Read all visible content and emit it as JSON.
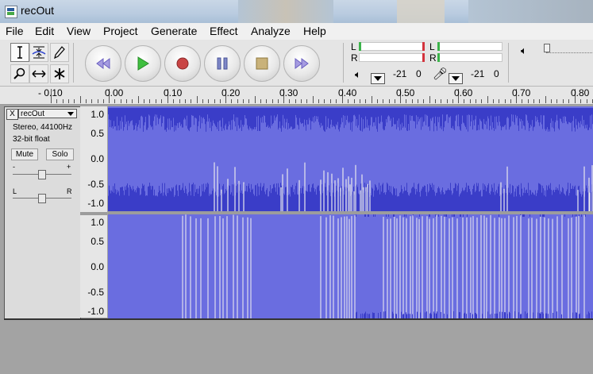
{
  "window": {
    "title": "recOut"
  },
  "menu": [
    "File",
    "Edit",
    "View",
    "Project",
    "Generate",
    "Effect",
    "Analyze",
    "Help"
  ],
  "tools": {
    "selection": "selection-tool-icon",
    "envelope": "envelope-tool-icon",
    "draw": "draw-tool-icon",
    "zoom": "zoom-tool-icon",
    "timeshift": "timeshift-tool-icon",
    "multi": "multi-tool-icon"
  },
  "transport": {
    "skip_start": "skip-to-start-icon",
    "play": "play-icon",
    "record": "record-icon",
    "pause": "pause-icon",
    "stop": "stop-icon",
    "skip_end": "skip-to-end-icon"
  },
  "meters": {
    "playback": {
      "L": "L",
      "R": "R",
      "scale_a": "-21",
      "scale_b": "0"
    },
    "record": {
      "L": "L",
      "R": "R",
      "scale_a": "-21",
      "scale_b": "0"
    }
  },
  "ruler": {
    "labels": [
      "- 0.10",
      "0.00",
      "0.10",
      "0.20",
      "0.30",
      "0.40",
      "0.50",
      "0.60",
      "0.70",
      "0.80"
    ]
  },
  "track": {
    "name": "recOut",
    "close": "X",
    "format": "Stereo, 44100Hz",
    "bits": "32-bit float",
    "mute": "Mute",
    "solo": "Solo",
    "gain_minus": "-",
    "gain_plus": "+",
    "pan_left": "L",
    "pan_right": "R"
  },
  "scale_labels": [
    "1.0",
    "0.5",
    "0.0",
    "-0.5",
    "-1.0"
  ],
  "colors": {
    "wave_background": "#6a6de0",
    "wave_dark": "#3a3dc8",
    "wave_light": "#e8e8ee",
    "accent": "#3bb34a",
    "record": "#d3333d"
  }
}
